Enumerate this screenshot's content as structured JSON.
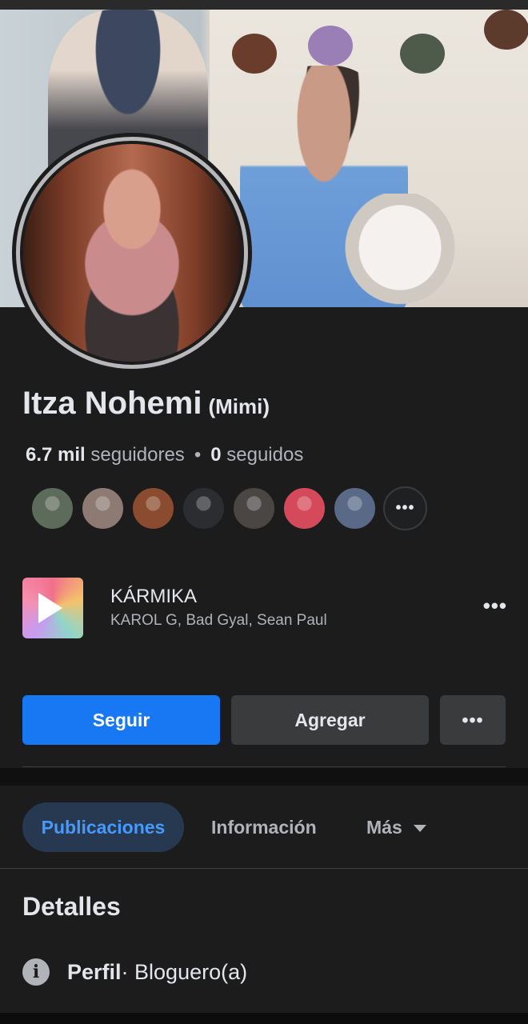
{
  "profile": {
    "name": "Itza Nohemi",
    "nickname": "(Mimi)",
    "followers_count": "6.7 mil",
    "followers_label": "seguidores",
    "following_count": "0",
    "following_label": "seguidos"
  },
  "follower_avatars": [
    {
      "color": "#5d6b5a"
    },
    {
      "color": "#8c7a73"
    },
    {
      "color": "#8a4b2e"
    },
    {
      "color": "#2b2d30"
    },
    {
      "color": "#4a4644"
    },
    {
      "color": "#d44a5a"
    },
    {
      "color": "#5a6a86"
    }
  ],
  "follower_more_label": "•••",
  "music": {
    "title": "KÁRMIKA",
    "artists": "KAROL G, Bad Gyal, Sean Paul",
    "more_label": "•••"
  },
  "actions": {
    "follow_label": "Seguir",
    "add_label": "Agregar",
    "more_label": "•••",
    "follow_color": "#1877f2"
  },
  "tabs": [
    {
      "label": "Publicaciones",
      "active": true
    },
    {
      "label": "Información",
      "active": false
    },
    {
      "label": "Más",
      "active": false
    }
  ],
  "details": {
    "title": "Detalles",
    "rows": [
      {
        "icon": "info-icon",
        "key": "Perfil",
        "value": " · Bloguero(a)"
      }
    ]
  }
}
